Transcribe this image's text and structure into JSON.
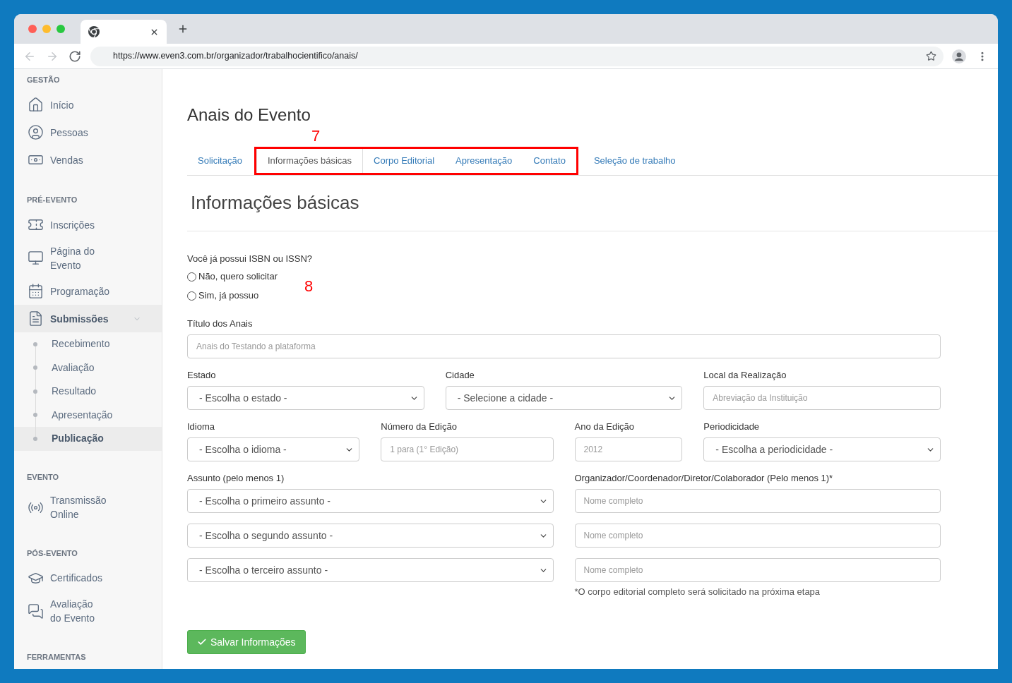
{
  "browser": {
    "url": "https://www.even3.com.br/organizador/trabalhocientifico/anais/",
    "nav": [
      {
        "kind": "back",
        "disabled": true
      },
      {
        "kind": "forward",
        "disabled": true
      },
      {
        "kind": "reload",
        "disabled": false
      }
    ]
  },
  "sidebar": {
    "sections": [
      {
        "title": "GESTÃO",
        "items": [
          {
            "label": "Início",
            "selected": false
          },
          {
            "label": "Pessoas",
            "selected": false
          },
          {
            "label": "Vendas",
            "selected": false
          }
        ]
      },
      {
        "title": "PRÉ-EVENTO",
        "items": [
          {
            "label": "Inscrições",
            "selected": false
          },
          {
            "label": "Página do Evento",
            "selected": false
          },
          {
            "label": "Programação",
            "selected": false
          },
          {
            "label": "Submissões",
            "selected": true,
            "expanded": true,
            "children": [
              {
                "label": "Recebimento",
                "selected": false
              },
              {
                "label": "Avaliação",
                "selected": false
              },
              {
                "label": "Resultado",
                "selected": false
              },
              {
                "label": "Apresentação",
                "selected": false
              },
              {
                "label": "Publicação",
                "selected": true
              }
            ]
          }
        ]
      },
      {
        "title": "EVENTO",
        "items": [
          {
            "label": "Transmissão Online",
            "selected": false
          }
        ]
      },
      {
        "title": "PÓS-EVENTO",
        "items": [
          {
            "label": "Certificados",
            "selected": false
          },
          {
            "label": "Avaliação do Evento",
            "selected": false
          }
        ]
      },
      {
        "title": "FERRAMENTAS"
      }
    ]
  },
  "page": {
    "title": "Anais do Evento",
    "highlight_label": "7",
    "tabs": [
      {
        "label": "Solicitação",
        "selected": false,
        "highlighted": false
      },
      {
        "label": "Informações básicas",
        "selected": true,
        "highlighted": true
      },
      {
        "label": "Corpo Editorial",
        "selected": false,
        "highlighted": true
      },
      {
        "label": "Apresentação",
        "selected": false,
        "highlighted": true
      },
      {
        "label": "Contato",
        "selected": false,
        "highlighted": true
      },
      {
        "label": "Seleção de trabalho",
        "selected": false,
        "highlighted": false
      }
    ],
    "section_title": "Informações básicas"
  },
  "form": {
    "isbn": {
      "question": "Você já possui ISBN ou ISSN?",
      "options": [
        {
          "label": "Não, quero solicitar",
          "selected": false
        },
        {
          "label": "Sim, já possuo",
          "selected": false
        }
      ],
      "annotation": "8"
    },
    "fields": [
      {
        "label": "Título dos Anais",
        "kind": "input",
        "placeholder": "Anais do Testando a plataforma"
      },
      {
        "label": "Estado",
        "kind": "select",
        "value": "- Escolha o estado -"
      },
      {
        "label": "Cidade",
        "kind": "select",
        "value": "- Selecione a cidade -"
      },
      {
        "label": "Local da Realização",
        "kind": "input",
        "placeholder": "Abreviação da Instituição"
      },
      {
        "label": "Idioma",
        "kind": "select",
        "value": "- Escolha o idioma -"
      },
      {
        "label": "Número da Edição",
        "kind": "input",
        "placeholder": "1 para (1° Edição)"
      },
      {
        "label": "Ano da Edição",
        "kind": "input",
        "placeholder": "2012"
      },
      {
        "label": "Periodicidade",
        "kind": "select",
        "value": "- Escolha a periodicidade -"
      }
    ],
    "subjects": {
      "label": "Assunto (pelo menos 1)",
      "selects": [
        {
          "value": "- Escolha o primeiro assunto -"
        },
        {
          "value": "- Escolha o segundo assunto -"
        },
        {
          "value": "- Escolha o terceiro assunto -"
        }
      ]
    },
    "organizers": {
      "label": "Organizador/Coordenador/Diretor/Colaborador (Pelo menos 1)*",
      "inputs": [
        {
          "placeholder": "Nome completo"
        },
        {
          "placeholder": "Nome completo"
        },
        {
          "placeholder": "Nome completo"
        }
      ],
      "note": "*O corpo editorial completo será solicitado na próxima etapa"
    },
    "save_button": {
      "label": "Salvar Informações"
    }
  }
}
